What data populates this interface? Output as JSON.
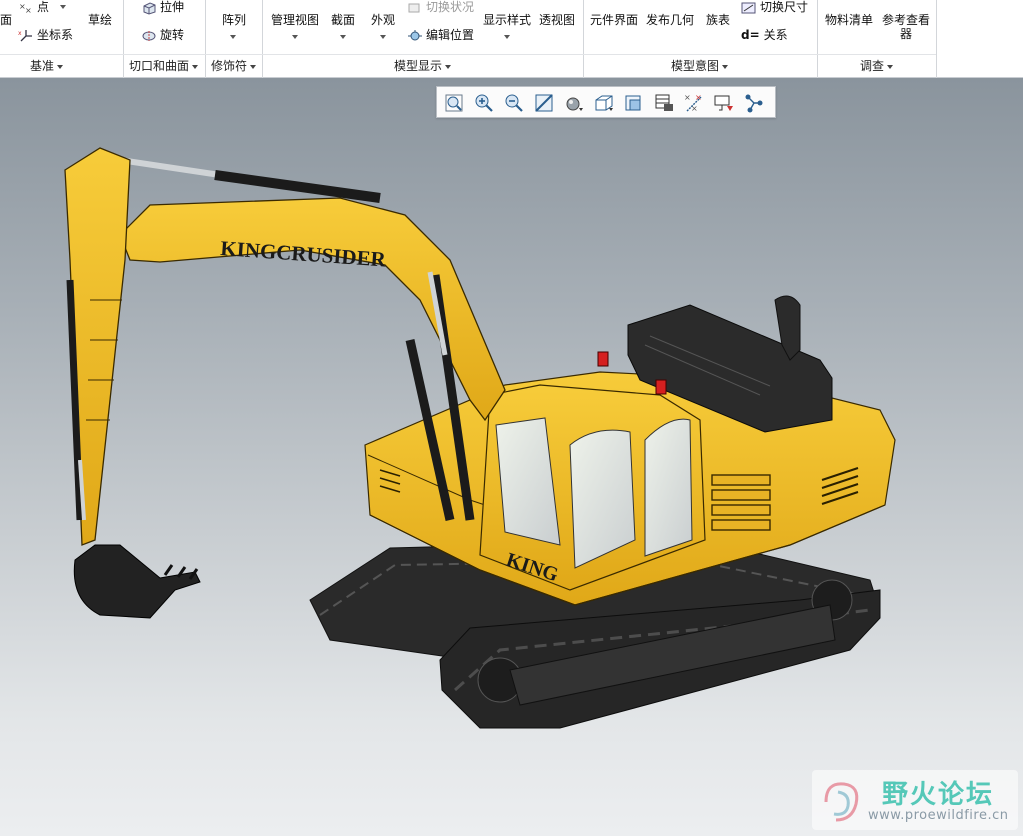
{
  "ribbon": {
    "datum": {
      "cut_label": "面",
      "point_label": "点",
      "csys_label": "坐标系",
      "sketch_label": "草绘",
      "group_label": "基准"
    },
    "shapes": {
      "extrude_label": "拉伸",
      "revolve_label": "旋转",
      "group_label": "切口和曲面"
    },
    "editing": {
      "pattern_label": "阵列",
      "group_label": "修饰符"
    },
    "model_display": {
      "manage_views_label": "管理视图",
      "section_label": "截面",
      "appearance_label": "外观",
      "toggle_status_label": "切换状况",
      "edit_position_label": "编辑位置",
      "display_style_label": "显示样式",
      "perspective_label": "透视图",
      "group_label": "模型显示"
    },
    "model_intent": {
      "component_interface_label": "元件界面",
      "publish_geometry_label": "发布几何",
      "family_table_label": "族表",
      "switch_dimensions_label": "切换尺寸",
      "relations_label": "关系",
      "group_label": "模型意图"
    },
    "investigate": {
      "bom_label": "物料清单",
      "reference_viewer_label": "参考查看器",
      "group_label": "调查"
    }
  },
  "graphics_toolbar": {
    "buttons": [
      "refit-icon",
      "zoom-in-icon",
      "zoom-out-icon",
      "repaint-icon",
      "display-style-icon",
      "saved-orientations-icon",
      "view-manager-icon",
      "perspective-icon",
      "datum-display-icon",
      "annotation-display-icon",
      "spin-center-icon"
    ]
  },
  "model": {
    "boom_brand": "KINGCRUSIDER",
    "cab_brand": "KING",
    "body_color": "#f2bf2c",
    "track_color": "#2a2a2a"
  },
  "watermark": {
    "title": "野火论坛",
    "url": "www.proewildfire.cn"
  }
}
